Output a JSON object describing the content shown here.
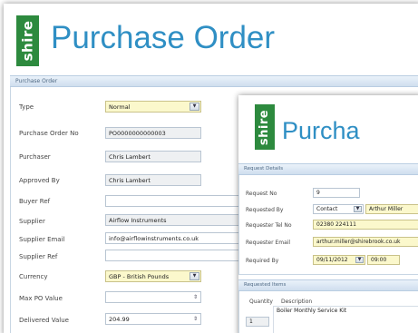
{
  "back": {
    "logo": "shire",
    "title": "Purchase Order",
    "section": "Purchase Order",
    "fields": [
      {
        "label": "Type",
        "value": "Normal"
      },
      {
        "label": "Purchase Order No",
        "value": "PO0000000000003"
      },
      {
        "label": "Purchaser",
        "value": "Chris Lambert"
      },
      {
        "label": "Approved By",
        "value": "Chris Lambert"
      },
      {
        "label": "Buyer Ref",
        "value": ""
      },
      {
        "label": "Supplier",
        "value": "Airflow Instruments"
      },
      {
        "label": "Supplier Email",
        "value": "info@airflowinstruments.co.uk"
      },
      {
        "label": "Supplier Ref",
        "value": ""
      },
      {
        "label": "Currency",
        "value": "GBP - British Pounds"
      },
      {
        "label": "Max PO Value",
        "value": ""
      },
      {
        "label": "Delivered Value",
        "value": "204.99"
      }
    ]
  },
  "front": {
    "logo": "shire",
    "title": "Purcha",
    "section_details": "Request Details",
    "fields": {
      "request_no": {
        "label": "Request No",
        "value": "9"
      },
      "requested_by": {
        "label": "Requested By",
        "type": "Contact",
        "value": "Arthur Miller"
      },
      "tel": {
        "label": "Requester Tel No",
        "value": "02380 224111"
      },
      "email": {
        "label": "Requester Email",
        "value": "arthur.miller@shirebrook.co.uk"
      },
      "required_by": {
        "label": "Required By",
        "date": "09/11/2012",
        "time": "09:00"
      }
    },
    "section_items": "Requested Items",
    "items_header": {
      "quantity": "Quantity",
      "description": "Description"
    },
    "items": [
      {
        "quantity": "1",
        "description": "Boiler Monthly Service Kit"
      }
    ]
  },
  "colors": {
    "logo_green": "#2d8a3e",
    "title_blue": "#2f8fc4",
    "highlight": "#fbf8cc"
  }
}
